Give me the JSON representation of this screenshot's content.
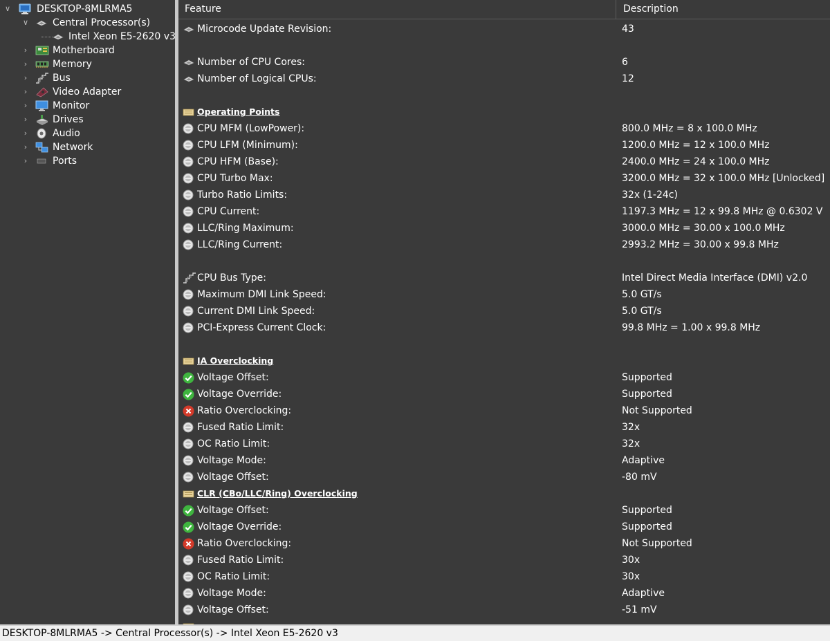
{
  "colors": {
    "background": "#3a3a3a",
    "text": "#ffffff",
    "splitter": "#c9c9c9",
    "status_bg": "#f0f0f0",
    "status_text": "#000000",
    "ok_icon": "#3fb53f",
    "error_icon": "#d43a2a"
  },
  "tree": {
    "root": {
      "label": "DESKTOP-8MLRMA5",
      "icon": "computer-icon",
      "expanded": true
    },
    "processor": {
      "label": "Central Processor(s)",
      "icon": "cpu-chip-icon",
      "expanded": true
    },
    "cpu": {
      "label": "Intel Xeon E5-2620 v3",
      "icon": "cpu-chip-icon"
    },
    "items": [
      {
        "label": "Motherboard",
        "icon": "motherboard-icon"
      },
      {
        "label": "Memory",
        "icon": "memory-icon"
      },
      {
        "label": "Bus",
        "icon": "bus-icon"
      },
      {
        "label": "Video Adapter",
        "icon": "video-adapter-icon"
      },
      {
        "label": "Monitor",
        "icon": "monitor-icon"
      },
      {
        "label": "Drives",
        "icon": "drives-icon"
      },
      {
        "label": "Audio",
        "icon": "audio-icon"
      },
      {
        "label": "Network",
        "icon": "network-icon"
      },
      {
        "label": "Ports",
        "icon": "ports-icon"
      }
    ]
  },
  "list": {
    "columns": {
      "feature": "Feature",
      "description": "Description"
    },
    "rows": [
      {
        "type": "item",
        "icon": "cpu-chip-icon",
        "feature": "Microcode Update Revision:",
        "description": "43"
      },
      {
        "type": "blank"
      },
      {
        "type": "item",
        "icon": "cpu-chip-icon",
        "feature": "Number of CPU Cores:",
        "description": "6"
      },
      {
        "type": "item",
        "icon": "cpu-chip-icon",
        "feature": "Number of Logical CPUs:",
        "description": "12"
      },
      {
        "type": "blank"
      },
      {
        "type": "section",
        "icon": "folder-icon",
        "feature": "Operating Points"
      },
      {
        "type": "item",
        "icon": "info-disc-icon",
        "feature": "CPU MFM (LowPower):",
        "description": "800.0 MHz = 8 x 100.0 MHz"
      },
      {
        "type": "item",
        "icon": "info-disc-icon",
        "feature": "CPU LFM (Minimum):",
        "description": "1200.0 MHz = 12 x 100.0 MHz"
      },
      {
        "type": "item",
        "icon": "info-disc-icon",
        "feature": "CPU HFM (Base):",
        "description": "2400.0 MHz = 24 x 100.0 MHz"
      },
      {
        "type": "item",
        "icon": "info-disc-icon",
        "feature": "CPU Turbo Max:",
        "description": "3200.0 MHz = 32 x 100.0 MHz [Unlocked]"
      },
      {
        "type": "item",
        "icon": "info-disc-icon",
        "feature": "Turbo Ratio Limits:",
        "description": "32x (1-24c)"
      },
      {
        "type": "item",
        "icon": "info-disc-icon",
        "feature": "CPU Current:",
        "description": "1197.3 MHz = 12 x 99.8 MHz @ 0.6302 V"
      },
      {
        "type": "item",
        "icon": "info-disc-icon",
        "feature": "LLC/Ring Maximum:",
        "description": "3000.0 MHz = 30.00 x 100.0 MHz"
      },
      {
        "type": "item",
        "icon": "info-disc-icon",
        "feature": "LLC/Ring Current:",
        "description": "2993.2 MHz = 30.00 x 99.8 MHz"
      },
      {
        "type": "blank"
      },
      {
        "type": "item",
        "icon": "bus-icon",
        "feature": "CPU Bus Type:",
        "description": "Intel Direct Media Interface (DMI) v2.0"
      },
      {
        "type": "item",
        "icon": "info-disc-icon",
        "feature": "Maximum DMI Link Speed:",
        "description": "5.0 GT/s"
      },
      {
        "type": "item",
        "icon": "info-disc-icon",
        "feature": "Current DMI Link Speed:",
        "description": "5.0 GT/s"
      },
      {
        "type": "item",
        "icon": "info-disc-icon",
        "feature": "PCI-Express Current Clock:",
        "description": "99.8 MHz = 1.00 x 99.8 MHz"
      },
      {
        "type": "blank"
      },
      {
        "type": "section",
        "icon": "folder-icon",
        "feature": "IA Overclocking"
      },
      {
        "type": "item",
        "icon": "check-icon",
        "feature": "Voltage Offset:",
        "description": "Supported"
      },
      {
        "type": "item",
        "icon": "check-icon",
        "feature": "Voltage Override:",
        "description": "Supported"
      },
      {
        "type": "item",
        "icon": "error-icon",
        "feature": "Ratio Overclocking:",
        "description": "Not Supported"
      },
      {
        "type": "item",
        "icon": "info-disc-icon",
        "feature": "Fused Ratio Limit:",
        "description": "32x"
      },
      {
        "type": "item",
        "icon": "info-disc-icon",
        "feature": "OC Ratio Limit:",
        "description": "32x"
      },
      {
        "type": "item",
        "icon": "info-disc-icon",
        "feature": "Voltage Mode:",
        "description": "Adaptive"
      },
      {
        "type": "item",
        "icon": "info-disc-icon",
        "feature": "Voltage Offset:",
        "description": "-80 mV"
      },
      {
        "type": "section",
        "icon": "folder-icon",
        "feature": "CLR (CBo/LLC/Ring) Overclocking"
      },
      {
        "type": "item",
        "icon": "check-icon",
        "feature": "Voltage Offset:",
        "description": "Supported"
      },
      {
        "type": "item",
        "icon": "check-icon",
        "feature": "Voltage Override:",
        "description": "Supported"
      },
      {
        "type": "item",
        "icon": "error-icon",
        "feature": "Ratio Overclocking:",
        "description": "Not Supported"
      },
      {
        "type": "item",
        "icon": "info-disc-icon",
        "feature": "Fused Ratio Limit:",
        "description": "30x"
      },
      {
        "type": "item",
        "icon": "info-disc-icon",
        "feature": "OC Ratio Limit:",
        "description": "30x"
      },
      {
        "type": "item",
        "icon": "info-disc-icon",
        "feature": "Voltage Mode:",
        "description": "Adaptive"
      },
      {
        "type": "item",
        "icon": "info-disc-icon",
        "feature": "Voltage Offset:",
        "description": "-51 mV"
      },
      {
        "type": "section",
        "icon": "folder-icon",
        "feature": ""
      }
    ]
  },
  "statusbar": {
    "text": "DESKTOP-8MLRMA5 -> Central Processor(s) -> Intel Xeon E5-2620 v3"
  }
}
